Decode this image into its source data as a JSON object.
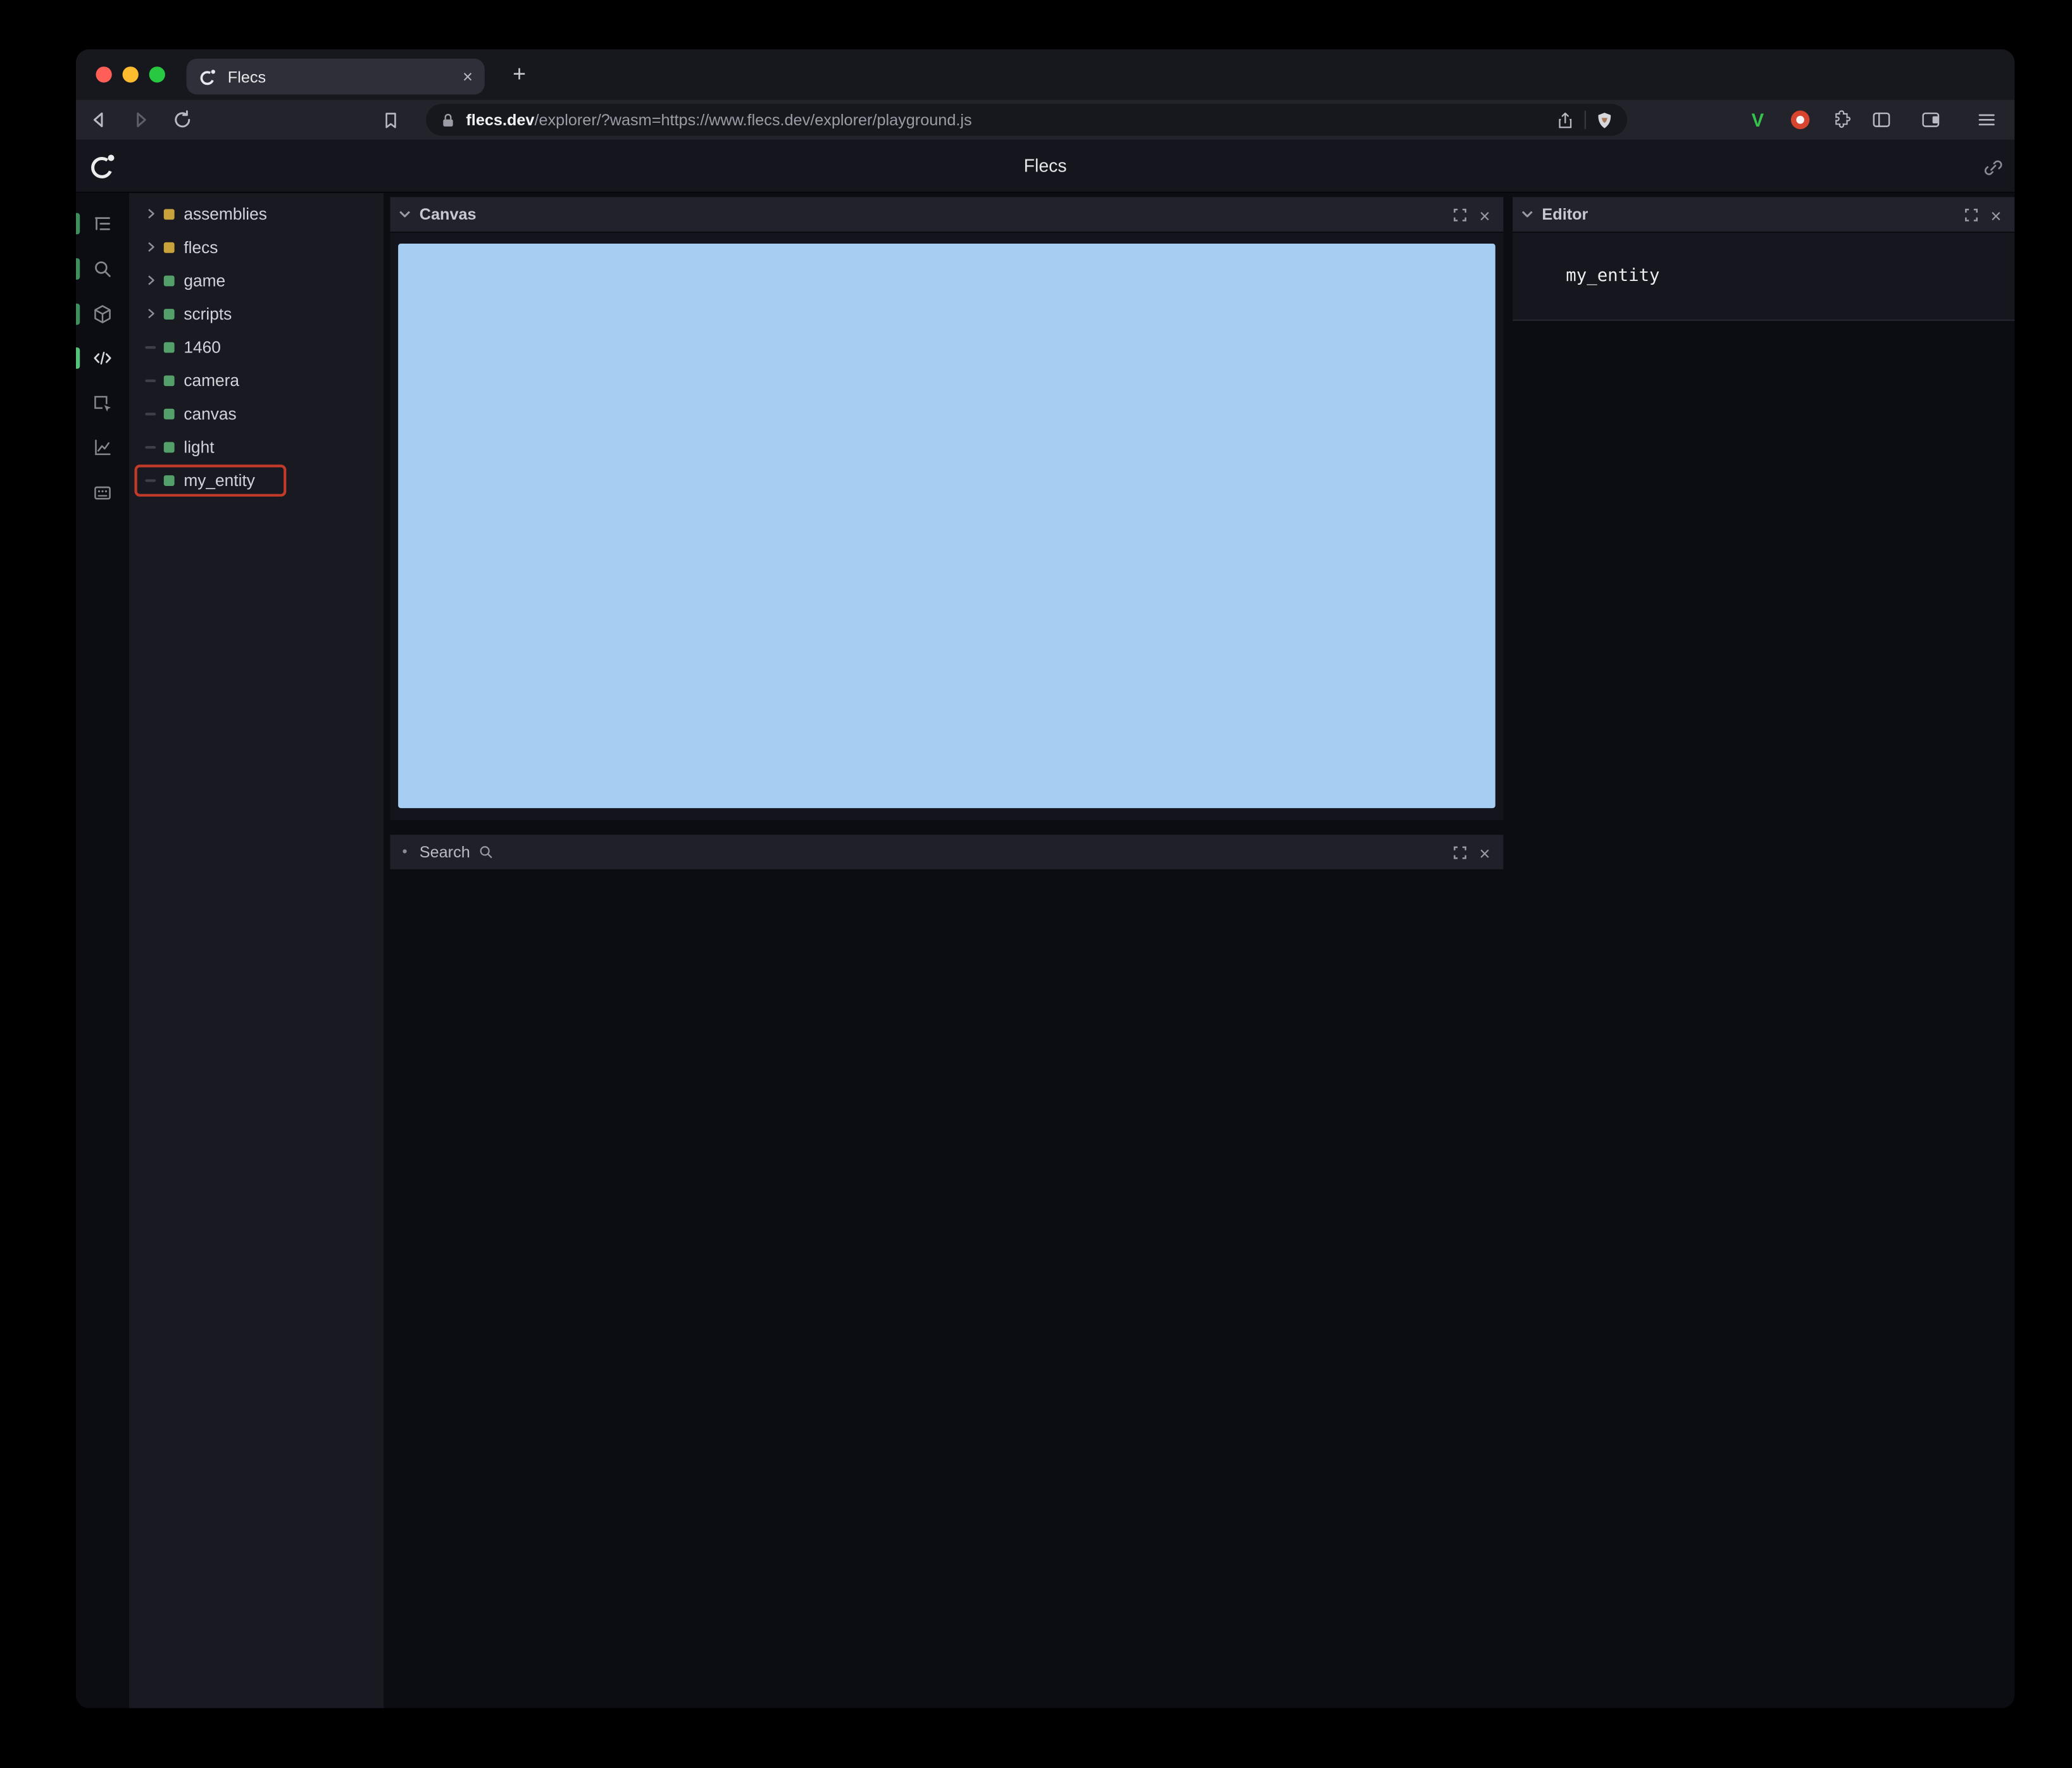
{
  "glyphs": {
    "plus": "+",
    "close": "×",
    "bullet": "•"
  },
  "browser": {
    "tab_title": "Flecs",
    "url_domain": "flecs.dev",
    "url_path": "/explorer/?wasm=https://www.flecs.dev/explorer/playground.js"
  },
  "app": {
    "header_title": "Flecs",
    "tree": {
      "items": [
        {
          "label": "assemblies",
          "color": "#c8a33c",
          "expandable": true
        },
        {
          "label": "flecs",
          "color": "#c8a33c",
          "expandable": true
        },
        {
          "label": "game",
          "color": "#54a06a",
          "expandable": true
        },
        {
          "label": "scripts",
          "color": "#54a06a",
          "expandable": true
        },
        {
          "label": "1460",
          "color": "#54a06a",
          "expandable": false
        },
        {
          "label": "camera",
          "color": "#54a06a",
          "expandable": false
        },
        {
          "label": "canvas",
          "color": "#54a06a",
          "expandable": false
        },
        {
          "label": "light",
          "color": "#54a06a",
          "expandable": false
        },
        {
          "label": "my_entity",
          "color": "#54a06a",
          "expandable": false,
          "highlighted": true
        }
      ]
    },
    "panels": {
      "canvas": {
        "title": "Canvas",
        "fill": "#a6cdf2"
      },
      "search": {
        "title": "Search"
      },
      "editor": {
        "title": "Editor",
        "content": "my_entity"
      }
    },
    "colors": {
      "annotation": "#c23a28",
      "rail_indicator": "#3f8f5c",
      "rail_indicator_active": "#55c27a"
    }
  }
}
